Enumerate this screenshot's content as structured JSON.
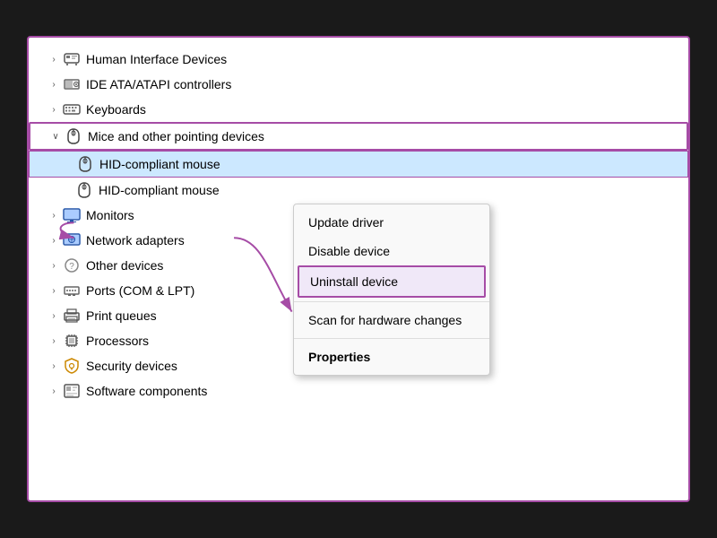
{
  "window": {
    "bg": "#1a1a1a"
  },
  "deviceTree": {
    "items": [
      {
        "id": "hid",
        "label": "Human Interface Devices",
        "icon": "🖱",
        "indent": 0,
        "expanded": false,
        "hasArrow": true
      },
      {
        "id": "ide",
        "label": "IDE ATA/ATAPI controllers",
        "icon": "💾",
        "indent": 0,
        "expanded": false,
        "hasArrow": true
      },
      {
        "id": "keyboards",
        "label": "Keyboards",
        "icon": "⌨",
        "indent": 0,
        "expanded": false,
        "hasArrow": true
      },
      {
        "id": "mice",
        "label": "Mice and other pointing devices",
        "icon": "🖱",
        "indent": 0,
        "expanded": true,
        "hasArrow": true,
        "highlighted": true
      },
      {
        "id": "hid-mouse-1",
        "label": "HID-compliant mouse",
        "icon": "🖱",
        "indent": 1,
        "child": true,
        "highlighted": true
      },
      {
        "id": "hid-mouse-2",
        "label": "HID-compliant mouse",
        "icon": "🖱",
        "indent": 1,
        "child": true
      },
      {
        "id": "monitors",
        "label": "Monitors",
        "icon": "🖥",
        "indent": 0,
        "expanded": false,
        "hasArrow": true
      },
      {
        "id": "network",
        "label": "Network adapters",
        "icon": "🌐",
        "indent": 0,
        "expanded": false,
        "hasArrow": true
      },
      {
        "id": "other",
        "label": "Other devices",
        "icon": "❓",
        "indent": 0,
        "expanded": false,
        "hasArrow": true
      },
      {
        "id": "ports",
        "label": "Ports (COM & LPT)",
        "icon": "🔌",
        "indent": 0,
        "expanded": false,
        "hasArrow": true
      },
      {
        "id": "print",
        "label": "Print queues",
        "icon": "🖨",
        "indent": 0,
        "expanded": false,
        "hasArrow": true
      },
      {
        "id": "processors",
        "label": "Processors",
        "icon": "⚙",
        "indent": 0,
        "expanded": false,
        "hasArrow": true
      },
      {
        "id": "security",
        "label": "Security devices",
        "icon": "🔑",
        "indent": 0,
        "expanded": false,
        "hasArrow": true
      },
      {
        "id": "software",
        "label": "Software components",
        "icon": "📦",
        "indent": 0,
        "expanded": false,
        "hasArrow": true
      }
    ]
  },
  "contextMenu": {
    "items": [
      {
        "id": "update-driver",
        "label": "Update driver",
        "bold": false,
        "highlighted": false
      },
      {
        "id": "disable-device",
        "label": "Disable device",
        "bold": false,
        "highlighted": false
      },
      {
        "id": "uninstall-device",
        "label": "Uninstall device",
        "bold": false,
        "highlighted": true
      },
      {
        "id": "scan-hardware",
        "label": "Scan for hardware changes",
        "bold": false,
        "highlighted": false
      },
      {
        "id": "properties",
        "label": "Properties",
        "bold": true,
        "highlighted": false
      }
    ]
  }
}
